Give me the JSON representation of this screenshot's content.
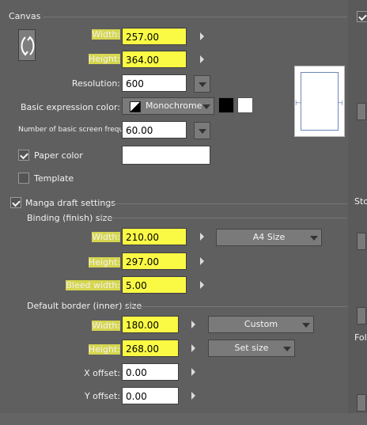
{
  "canvas": {
    "section_label": "Canvas",
    "width_label": "Width:",
    "width_value": "257.00",
    "height_label": "Height:",
    "height_value": "364.00",
    "resolution_label": "Resolution:",
    "resolution_value": "600",
    "basic_expression_color_label": "Basic expression color:",
    "basic_expression_color_value": "Monochrome",
    "screen_frequency_label": "Number of basic screen frequency:",
    "screen_frequency_value": "60.00",
    "paper_color_label": "Paper color",
    "template_label": "Template"
  },
  "manga": {
    "section_label": "Manga draft settings",
    "binding_label": "Binding (finish) size",
    "width_label": "Width:",
    "width_value": "210.00",
    "height_label": "Height:",
    "height_value": "297.00",
    "bleed_label": "Bleed width:",
    "bleed_value": "5.00",
    "preset_label": "A4 Size",
    "border_label": "Default border (inner) size",
    "border_width_label": "Width:",
    "border_width_value": "180.00",
    "border_height_label": "Height:",
    "border_height_value": "268.00",
    "custom_label": "Custom",
    "set_size_label": "Set size",
    "x_offset_label": "X offset:",
    "x_offset_value": "0.00",
    "y_offset_label": "Y offset:",
    "y_offset_value": "0.00"
  },
  "right": {
    "sto_label": "Sto",
    "fol_label": "Fol"
  },
  "colors": {
    "panel": "#5f5f5f",
    "highlight": "#ffff00",
    "field": "#ffffff"
  },
  "icons": [
    "rotate-canvas-icon",
    "checkbox-checked-icon",
    "dropdown-arrow-icon",
    "spinner-right-icon"
  ]
}
